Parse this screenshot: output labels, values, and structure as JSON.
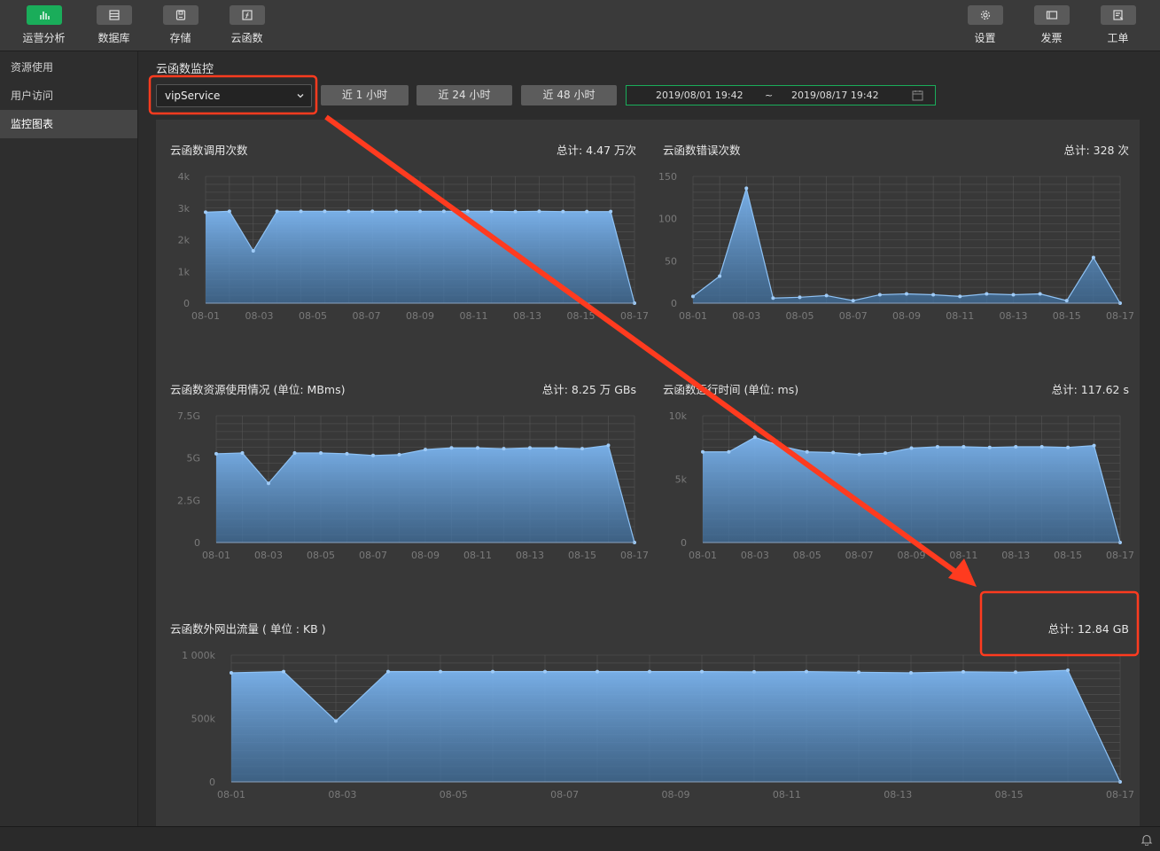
{
  "toolbar": {
    "left": [
      {
        "label": "运营分析",
        "icon": "bar-chart-icon",
        "active": true
      },
      {
        "label": "数据库",
        "icon": "database-icon",
        "active": false
      },
      {
        "label": "存储",
        "icon": "storage-icon",
        "active": false
      },
      {
        "label": "云函数",
        "icon": "cloud-function-icon",
        "active": false
      }
    ],
    "right": [
      {
        "label": "设置",
        "icon": "gear-icon"
      },
      {
        "label": "发票",
        "icon": "invoice-icon"
      },
      {
        "label": "工单",
        "icon": "ticket-icon"
      }
    ]
  },
  "sidebar": {
    "items": [
      {
        "label": "资源使用",
        "active": false
      },
      {
        "label": "用户访问",
        "active": false
      },
      {
        "label": "监控图表",
        "active": true
      }
    ]
  },
  "main": {
    "title": "云函数监控",
    "function_select": {
      "value": "vipService"
    },
    "range_buttons": [
      "近 1 小时",
      "近 24 小时",
      "近 48 小时"
    ],
    "date_range": {
      "start": "2019/08/01 19:42",
      "separator": "~",
      "end": "2019/08/17 19:42"
    }
  },
  "colors": {
    "accent": "#1aad5a",
    "area": "#6aa8ec",
    "annotation": "#ff3b1f"
  },
  "chart_data": [
    {
      "type": "area",
      "title": "云函数调用次数",
      "total": "总计: 4.47 万次",
      "y_ticks": [
        "0",
        "1k",
        "2k",
        "3k",
        "4k"
      ],
      "x_ticks": [
        "08-01",
        "08-03",
        "08-05",
        "08-07",
        "08-09",
        "08-11",
        "08-13",
        "08-15",
        "08-17"
      ],
      "ylim": [
        0,
        4000
      ],
      "values": [
        2870,
        2900,
        1650,
        2900,
        2900,
        2900,
        2900,
        2900,
        2900,
        2900,
        2900,
        2900,
        2900,
        2890,
        2900,
        2890,
        2890,
        2890,
        0
      ]
    },
    {
      "type": "area",
      "title": "云函数错误次数",
      "total": "总计: 328 次",
      "y_ticks": [
        "0",
        "50",
        "100",
        "150"
      ],
      "x_ticks": [
        "08-01",
        "08-03",
        "08-05",
        "08-07",
        "08-09",
        "08-11",
        "08-13",
        "08-15",
        "08-17"
      ],
      "ylim": [
        0,
        150
      ],
      "values": [
        8,
        32,
        136,
        6,
        7,
        9,
        3,
        10,
        11,
        10,
        8,
        11,
        10,
        11,
        3,
        54,
        0
      ]
    },
    {
      "type": "area",
      "title": "云函数资源使用情况 (单位: MBms)",
      "total": "总计: 8.25 万 GBs",
      "y_ticks": [
        "0",
        "2.5G",
        "5G",
        "7.5G"
      ],
      "x_ticks": [
        "08-01",
        "08-03",
        "08-05",
        "08-07",
        "08-09",
        "08-11",
        "08-13",
        "08-15",
        "08-17"
      ],
      "ylim": [
        0,
        7.5
      ],
      "values": [
        5.25,
        5.3,
        3.5,
        5.3,
        5.3,
        5.25,
        5.15,
        5.2,
        5.5,
        5.6,
        5.6,
        5.55,
        5.6,
        5.6,
        5.55,
        5.75,
        0
      ]
    },
    {
      "type": "area",
      "title": "云函数运行时间 (单位: ms)",
      "total": "总计: 117.62 s",
      "y_ticks": [
        "0",
        "5k",
        "10k"
      ],
      "x_ticks": [
        "08-01",
        "08-03",
        "08-05",
        "08-07",
        "08-09",
        "08-11",
        "08-13",
        "08-15",
        "08-17"
      ],
      "ylim": [
        0,
        10000
      ],
      "values": [
        7150,
        7150,
        8300,
        7600,
        7150,
        7100,
        6950,
        7050,
        7450,
        7550,
        7550,
        7500,
        7550,
        7550,
        7500,
        7650,
        0
      ]
    },
    {
      "type": "area",
      "title": "云函数外网出流量 ( 单位 : KB )",
      "total": "总计: 12.84 GB",
      "y_ticks": [
        "0",
        "500k",
        "1 000k"
      ],
      "x_ticks": [
        "08-01",
        "08-03",
        "08-05",
        "08-07",
        "08-09",
        "08-11",
        "08-13",
        "08-15",
        "08-17"
      ],
      "ylim": [
        0,
        1000
      ],
      "values": [
        860,
        870,
        480,
        870,
        870,
        870,
        870,
        870,
        870,
        870,
        868,
        870,
        865,
        860,
        868,
        865,
        880,
        0
      ]
    }
  ]
}
